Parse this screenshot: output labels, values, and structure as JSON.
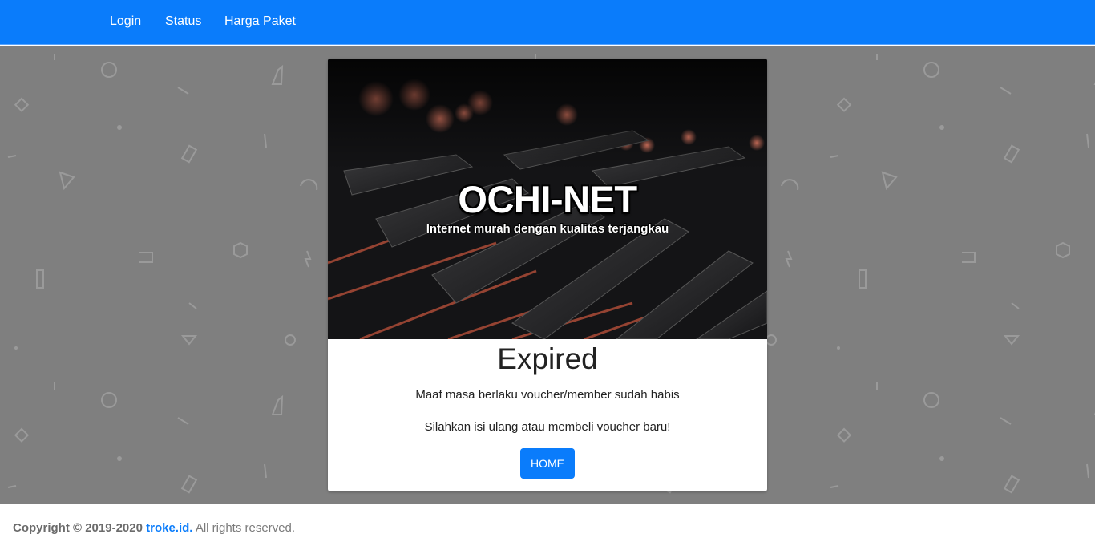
{
  "navbar": {
    "links": [
      "Login",
      "Status",
      "Harga Paket"
    ],
    "color": "#0a7cfb"
  },
  "hero": {
    "title": "OCHI-NET",
    "subtitle": "Internet murah dengan kualitas terjangkau"
  },
  "card": {
    "title": "Expired",
    "message1": "Maaf masa berlaku voucher/member sudah habis",
    "message2": "Silahkan isi ulang atau membeli voucher baru!",
    "button_label": "HOME"
  },
  "footer": {
    "copyright": "Copyright © 2019-2020",
    "brand": "troke.id.",
    "rights": "All rights reserved."
  },
  "colors": {
    "accent": "#0a7cfb",
    "background": "#7f7f7f"
  }
}
